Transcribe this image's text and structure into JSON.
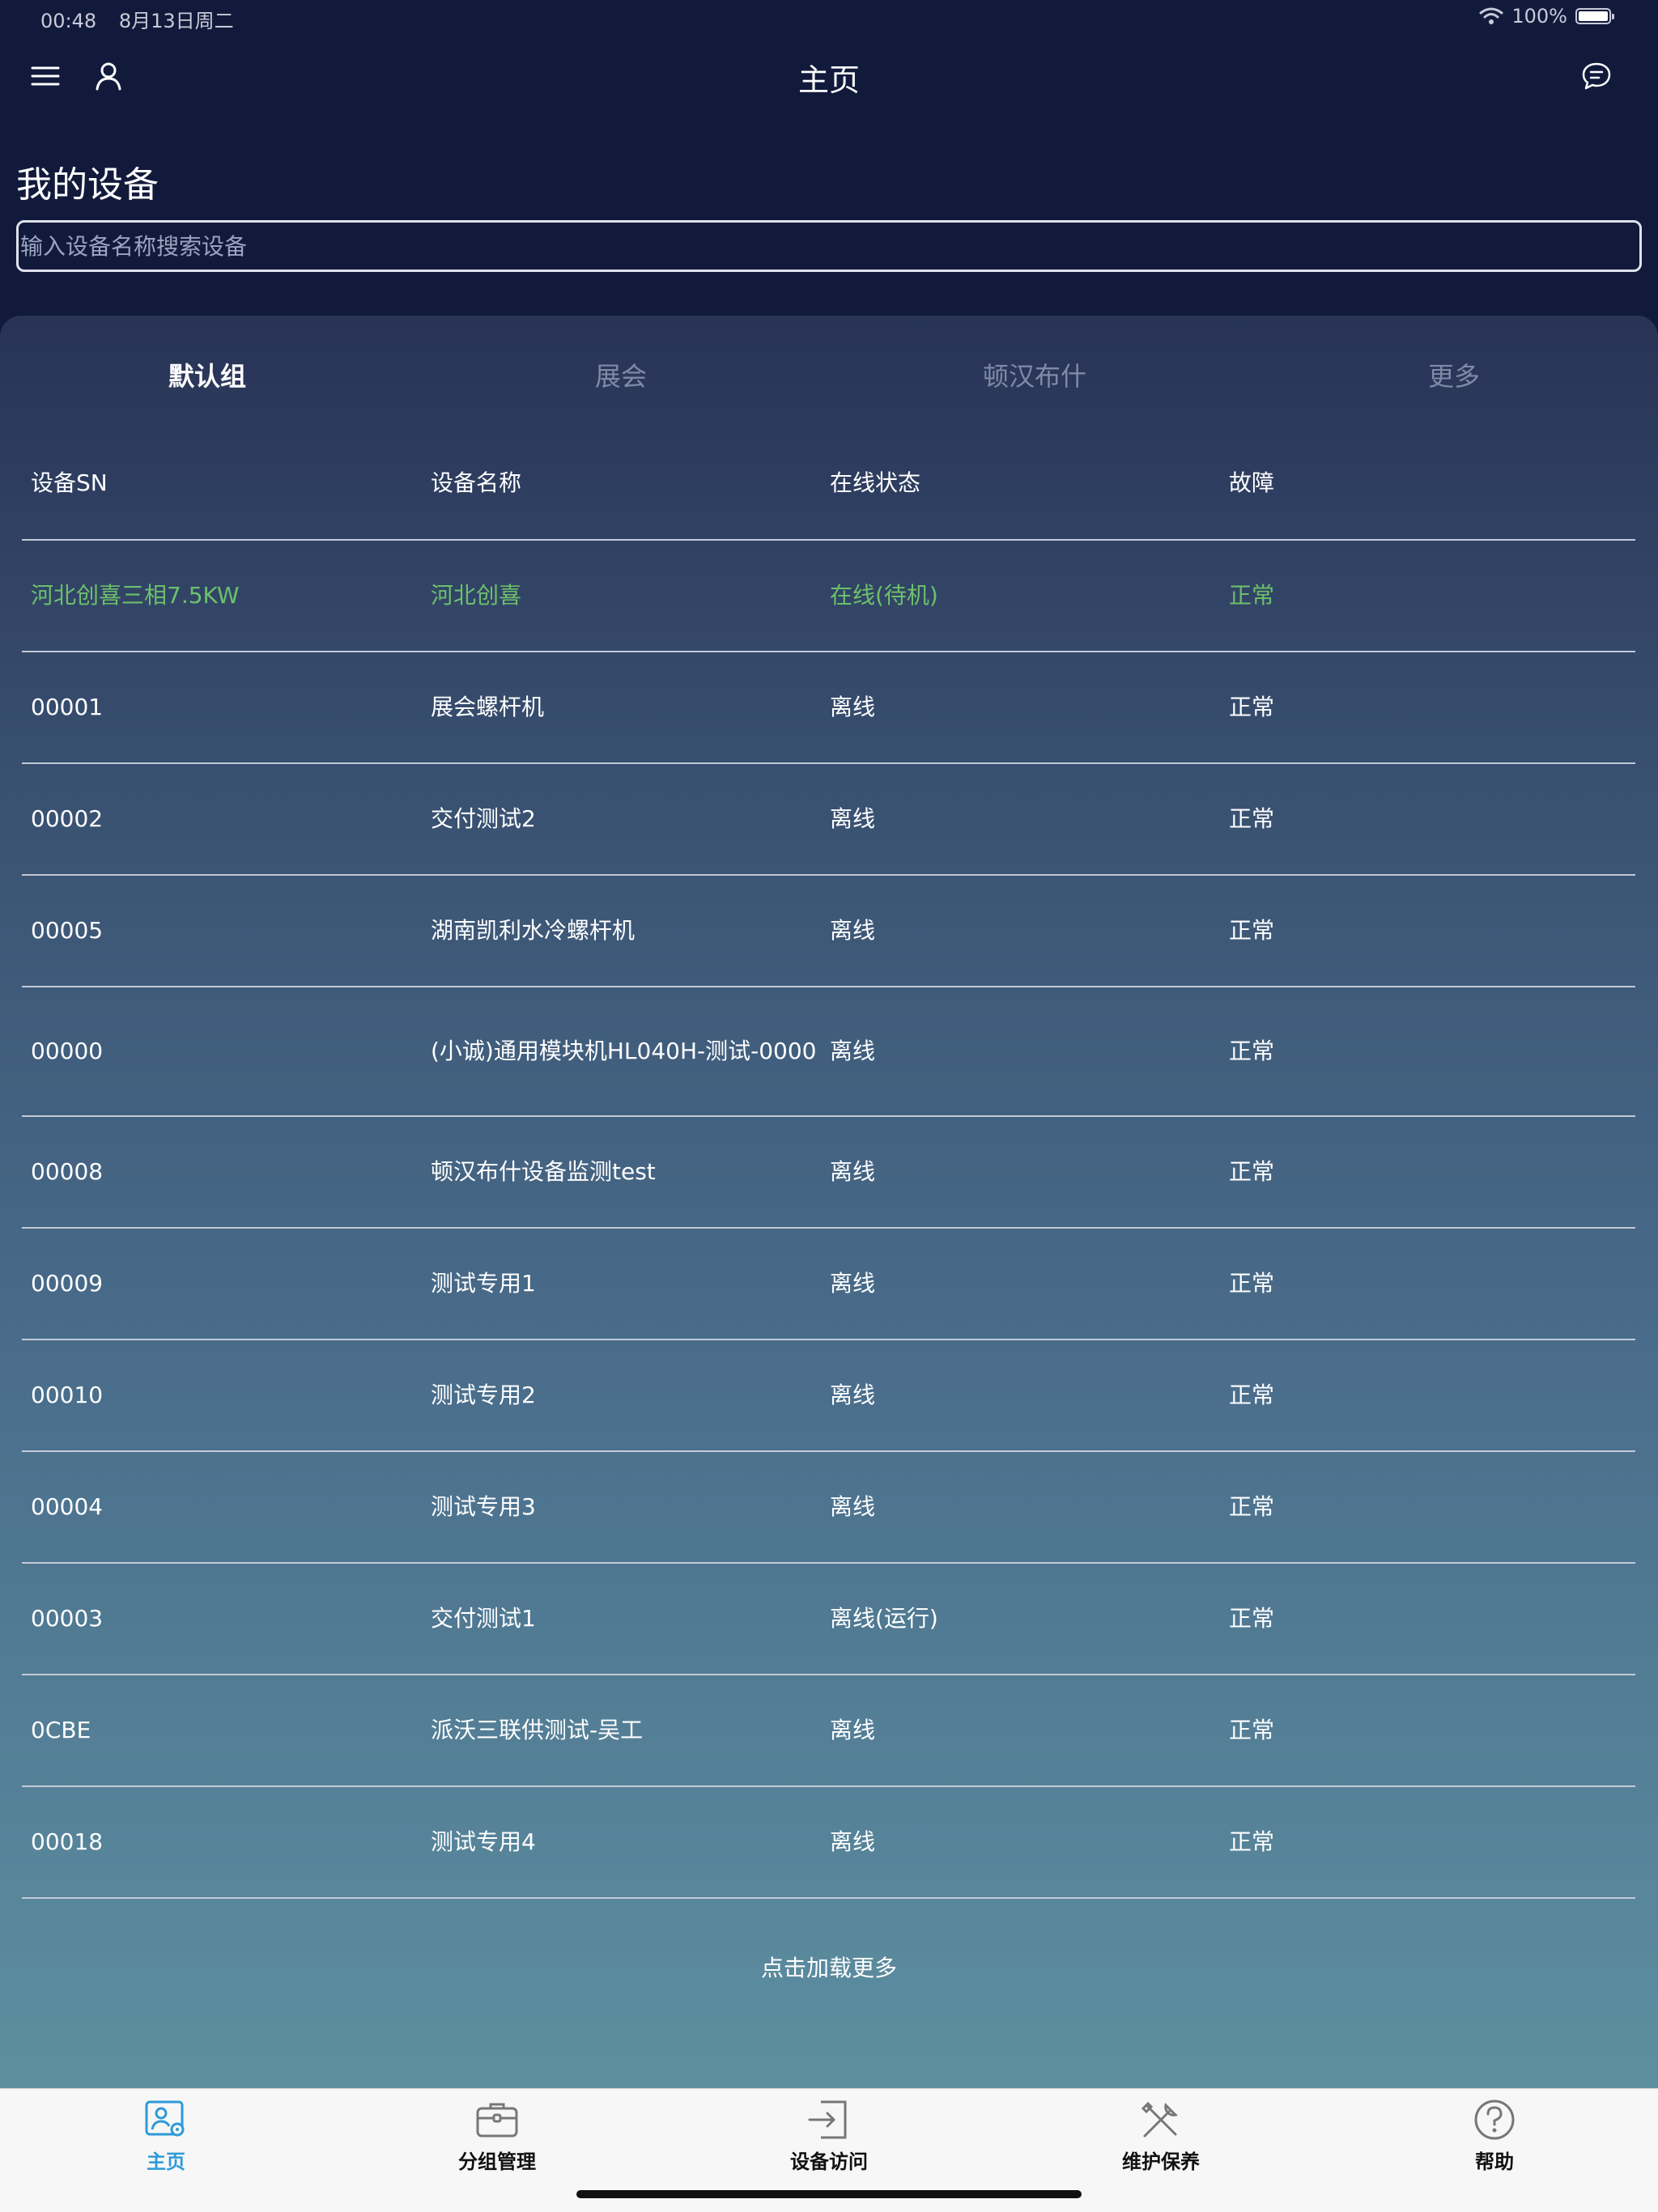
{
  "status_bar": {
    "time": "00:48",
    "date": "8月13日周二",
    "battery": "100%"
  },
  "nav": {
    "title": "主页",
    "menu_icon": "menu-icon",
    "profile_icon": "user-icon",
    "message_icon": "chat-icon"
  },
  "section_title": "我的设备",
  "search": {
    "placeholder": "输入设备名称搜索设备",
    "value": ""
  },
  "tabs": [
    {
      "label": "默认组",
      "active": true
    },
    {
      "label": "展会",
      "active": false
    },
    {
      "label": "顿汉布什",
      "active": false
    },
    {
      "label": "更多",
      "active": false
    }
  ],
  "table": {
    "headers": [
      "设备SN",
      "设备名称",
      "在线状态",
      "故障"
    ],
    "rows": [
      {
        "sn": "河北创喜三相7.5KW",
        "name": "河北创喜",
        "status": "在线(待机)",
        "fault": "正常"
      },
      {
        "sn": "00001",
        "name": "展会螺杆机",
        "status": "离线",
        "fault": "正常"
      },
      {
        "sn": "00002",
        "name": "交付测试2",
        "status": "离线",
        "fault": "正常"
      },
      {
        "sn": "00005",
        "name": "湖南凯利水冷螺杆机",
        "status": "离线",
        "fault": "正常"
      },
      {
        "sn": "00000",
        "name": "(小诚)通用模块机HL040H-测试-0000",
        "status": "离线",
        "fault": "正常"
      },
      {
        "sn": "00008",
        "name": "顿汉布什设备监测test",
        "status": "离线",
        "fault": "正常"
      },
      {
        "sn": "00009",
        "name": "测试专用1",
        "status": "离线",
        "fault": "正常"
      },
      {
        "sn": "00010",
        "name": "测试专用2",
        "status": "离线",
        "fault": "正常"
      },
      {
        "sn": "00004",
        "name": "测试专用3",
        "status": "离线",
        "fault": "正常"
      },
      {
        "sn": "00003",
        "name": "交付测试1",
        "status": "离线(运行)",
        "fault": "正常"
      },
      {
        "sn": "0CBE",
        "name": "派沃三联供测试-吴工",
        "status": "离线",
        "fault": "正常"
      },
      {
        "sn": "00018",
        "name": "测试专用4",
        "status": "离线",
        "fault": "正常"
      }
    ]
  },
  "load_more": "点击加载更多",
  "tabbar": [
    {
      "label": "主页",
      "icon": "home-device-icon",
      "active": true
    },
    {
      "label": "分组管理",
      "icon": "briefcase-icon",
      "active": false
    },
    {
      "label": "设备访问",
      "icon": "login-arrow-icon",
      "active": false
    },
    {
      "label": "维护保养",
      "icon": "tools-icon",
      "active": false
    },
    {
      "label": "帮助",
      "icon": "help-icon",
      "active": false
    }
  ],
  "colors": {
    "background_top": "#121a3c",
    "online_green": "#6cc06b",
    "active_tab_blue": "#2e9ad8"
  }
}
